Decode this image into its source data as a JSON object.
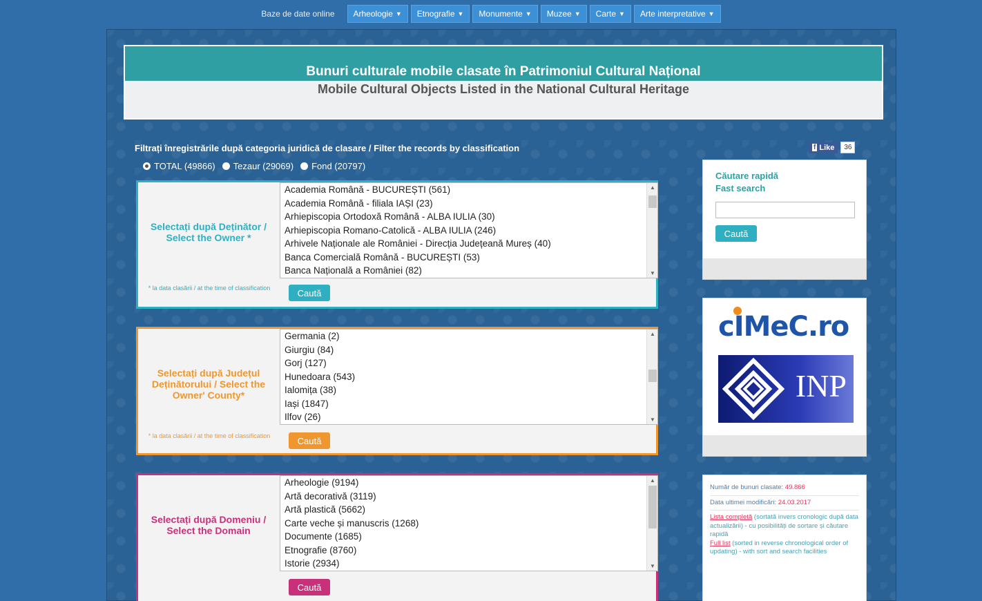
{
  "nav": {
    "lead": "Baze de date online",
    "items": [
      "Arheologie",
      "Etnografie",
      "Monumente",
      "Muzee",
      "Carte",
      "Arte interpretative"
    ]
  },
  "banner": {
    "title_ro": "Bunuri culturale mobile clasate în Patrimoniul Cultural Național",
    "title_en": "Mobile Cultural Objects Listed in the National Cultural Heritage"
  },
  "filter": {
    "title": "Filtrați înregistrările după categoria juridică de clasare / Filter the records by classification",
    "options": [
      {
        "label": "TOTAL (49866)",
        "selected": true
      },
      {
        "label": "Tezaur (29069)",
        "selected": false
      },
      {
        "label": "Fond (20797)",
        "selected": false
      }
    ]
  },
  "facebook": {
    "like": "Like",
    "count": "36"
  },
  "owner": {
    "label": "Selectați după Deținător / Select the Owner *",
    "note": "* la data clasării / at the time of classification",
    "button": "Caută",
    "color": "#2fb0c2",
    "options": [
      "Academia Română - BUCUREȘTI (561)",
      "Academia Română - filiala IAȘI (23)",
      "Arhiepiscopia Ortodoxă Română - ALBA IULIA (30)",
      "Arhiepiscopia Romano-Catolică - ALBA IULIA (246)",
      "Arhivele Naționale ale României - Direcția Județeană Mureș (40)",
      "Banca Comercială Română - BUCUREȘTI (53)",
      "Banca Națională a României (82)"
    ]
  },
  "county": {
    "label": "Selectați după Județul Deținătorului / Select the Owner' County*",
    "note": "* la data clasării / at the time of classification",
    "button": "Caută",
    "color": "#f0962e",
    "options": [
      "Germania (2)",
      "Giurgiu (84)",
      "Gorj (127)",
      "Hunedoara (543)",
      "Ialomița (38)",
      "Iași (1847)",
      "Ilfov (26)"
    ]
  },
  "domain": {
    "label": "Selectați după Domeniu / Select the Domain",
    "button": "Caută",
    "color": "#c8307a",
    "options": [
      "Arheologie (9194)",
      "Artă decorativă (3119)",
      "Artă plastică (5662)",
      "Carte veche și manuscris (1268)",
      "Documente (1685)",
      "Etnografie (8760)",
      "Istorie (2934)"
    ]
  },
  "quicksearch": {
    "title_ro": "Căutare rapidă",
    "title_en": "Fast search",
    "button": "Caută"
  },
  "logos": {
    "cimec": "cIMeC.ro",
    "inp": "INP"
  },
  "info": {
    "count_label": "Număr de bunuri clasate:",
    "count_value": "49.866",
    "date_label": "Data ultimei modificări:",
    "date_value": "24.03.2017",
    "list_link_ro": "Lista completă",
    "list_text_ro": "(sortată invers cronologic după data actualizării) - cu posibilități de sortare și căutare rapidă",
    "list_link_en": "Full list",
    "list_text_en": "(sorted in reverse chronological order of updating) - with sort and search facilities"
  }
}
